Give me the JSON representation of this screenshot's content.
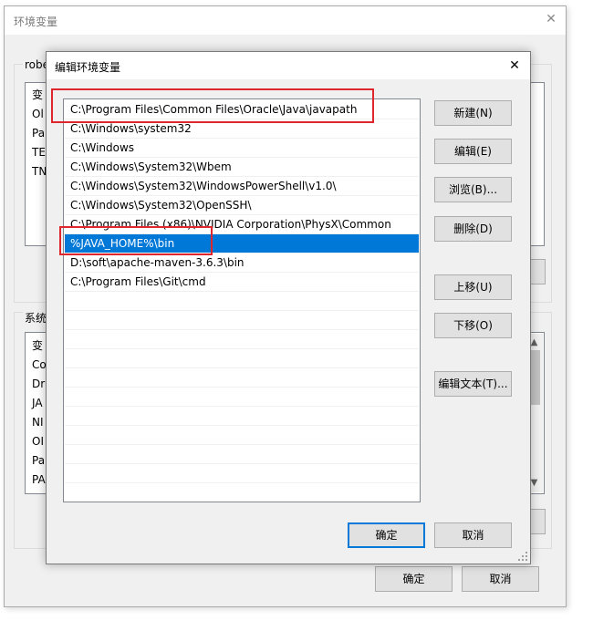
{
  "outer_dialog": {
    "title": "环境变量",
    "close_icon": "close-icon",
    "user_group_label": "robe",
    "system_group_label": "系统",
    "user_rows": [
      "变",
      "Ol",
      "Pa",
      "TE",
      "TN"
    ],
    "system_rows": [
      "变",
      "Co",
      "Dr",
      "JA",
      "NI",
      "OI",
      "Pa",
      "PA"
    ],
    "ok_label": "确定",
    "cancel_label": "取消"
  },
  "dialog": {
    "title": "编辑环境变量",
    "close_icon": "close-icon",
    "paths": [
      "C:\\Program Files\\Common Files\\Oracle\\Java\\javapath",
      "C:\\Windows\\system32",
      "C:\\Windows",
      "C:\\Windows\\System32\\Wbem",
      "C:\\Windows\\System32\\WindowsPowerShell\\v1.0\\",
      "C:\\Windows\\System32\\OpenSSH\\",
      "C:\\Program Files (x86)\\NVIDIA Corporation\\PhysX\\Common",
      "%JAVA_HOME%\\bin",
      "D:\\soft\\apache-maven-3.6.3\\bin",
      "C:\\Program Files\\Git\\cmd"
    ],
    "selected_index": 7,
    "buttons": {
      "new": "新建(N)",
      "edit": "编辑(E)",
      "browse": "浏览(B)...",
      "delete": "删除(D)",
      "move_up": "上移(U)",
      "move_down": "下移(O)",
      "edit_text": "编辑文本(T)..."
    },
    "ok_label": "确定",
    "cancel_label": "取消"
  },
  "colors": {
    "selection": "#0078d7",
    "annotation": "#e0262d",
    "dialog_bg": "#f0f0f0"
  }
}
